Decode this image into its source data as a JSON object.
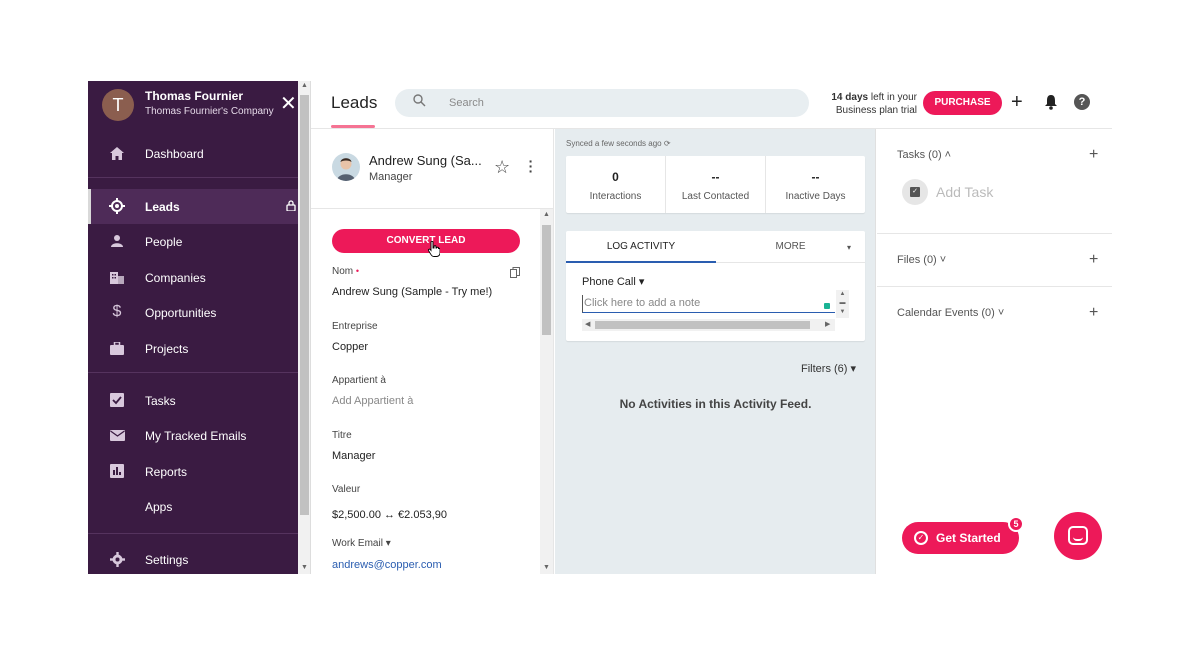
{
  "sidebar": {
    "avatar_initial": "T",
    "user_name": "Thomas Fournier",
    "company": "Thomas Fournier's Company",
    "close_glyph": "✕",
    "items": [
      {
        "label": "Dashboard",
        "icon": "home-icon"
      },
      {
        "label": "Leads",
        "icon": "target-icon",
        "active": true
      },
      {
        "label": "People",
        "icon": "person-icon"
      },
      {
        "label": "Companies",
        "icon": "building-icon"
      },
      {
        "label": "Opportunities",
        "icon": "dollar-icon"
      },
      {
        "label": "Projects",
        "icon": "briefcase-icon"
      },
      {
        "label": "Tasks",
        "icon": "checkbox-icon"
      },
      {
        "label": "My Tracked Emails",
        "icon": "envelope-icon"
      },
      {
        "label": "Reports",
        "icon": "bar-chart-icon"
      },
      {
        "label": "Apps",
        "icon": ""
      },
      {
        "label": "Settings",
        "icon": "gear-icon"
      }
    ]
  },
  "topbar": {
    "title": "Leads",
    "search_placeholder": "Search",
    "trial_days": "14 days",
    "trial_line1_rest": " left in your",
    "trial_line2": "Business plan trial",
    "purchase_label": "PURCHASE",
    "plus_glyph": "+",
    "help_glyph": "?"
  },
  "lead": {
    "name": "Andrew Sung (Sa...",
    "role": "Manager",
    "convert_label": "CONVERT LEAD",
    "fields": {
      "nom_label": "Nom",
      "nom_value": "Andrew Sung (Sample - Try me!)",
      "entreprise_label": "Entreprise",
      "entreprise_value": "Copper",
      "appartient_label": "Appartient à",
      "appartient_placeholder": "Add Appartient à",
      "titre_label": "Titre",
      "titre_value": "Manager",
      "valeur_label": "Valeur",
      "valeur_value": "$2,500.00 ↔ €2.053,90",
      "email_label": "Work Email ▾",
      "email_value": "andrews@copper.com"
    }
  },
  "feed": {
    "synced": "Synced a few seconds ago ⟳",
    "stats": [
      {
        "value": "0",
        "label": "Interactions"
      },
      {
        "value": "--",
        "label": "Last Contacted"
      },
      {
        "value": "--",
        "label": "Inactive Days"
      }
    ],
    "tab_log": "LOG ACTIVITY",
    "tab_more": "MORE",
    "activity_type": "Phone Call ▾",
    "note_placeholder": "Click here to add a note",
    "filters": "Filters (6) ▾",
    "empty_message": "No Activities in this Activity Feed."
  },
  "right_panel": {
    "tasks_label": "Tasks (0) ˄",
    "add_task": "Add Task",
    "files_label": "Files (0) ˅",
    "calendar_label": "Calendar Events (0) ˅",
    "plus_glyph": "+"
  },
  "get_started": {
    "label": "Get Started",
    "badge": "5"
  },
  "colors": {
    "sidebar_bg": "#3a1b42",
    "accent": "#ed1959",
    "feed_bg": "#e6ecef",
    "link": "#2a5db0"
  }
}
